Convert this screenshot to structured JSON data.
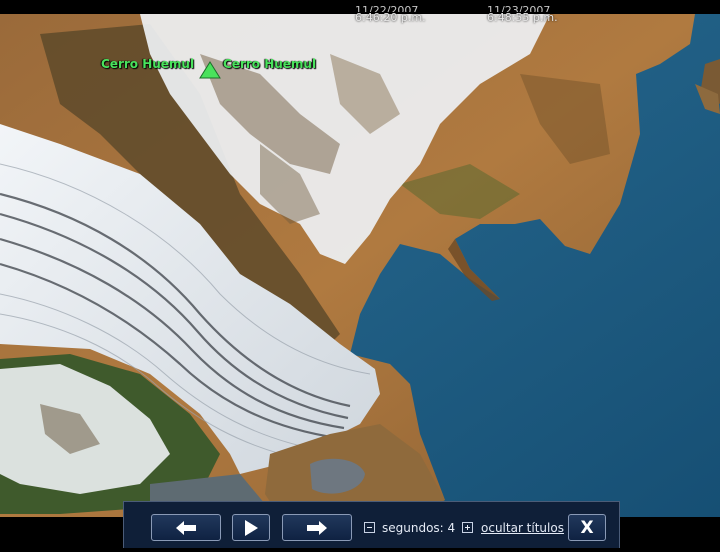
{
  "scene": {
    "timestamps": [
      {
        "date": "11/22/2007",
        "time": "6:46:20 p.m."
      },
      {
        "date": "11/23/2007",
        "time": "6:48:55 p.m."
      }
    ],
    "place_labels": [
      "Cerro Huemul",
      "Cerro Huemul"
    ],
    "icons": {
      "peak": "mountain-peak-icon"
    },
    "colors": {
      "label": "#49e25c",
      "water": "#1a5a80",
      "ice": "#e9eef3",
      "land": "#a8763e"
    }
  },
  "controls": {
    "prev_icon": "arrow-left-icon",
    "play_icon": "play-icon",
    "next_icon": "arrow-right-icon",
    "seconds_label": "segundos:",
    "seconds_value": "4",
    "hide_titles": "ocultar títulos",
    "close_label": "X"
  }
}
